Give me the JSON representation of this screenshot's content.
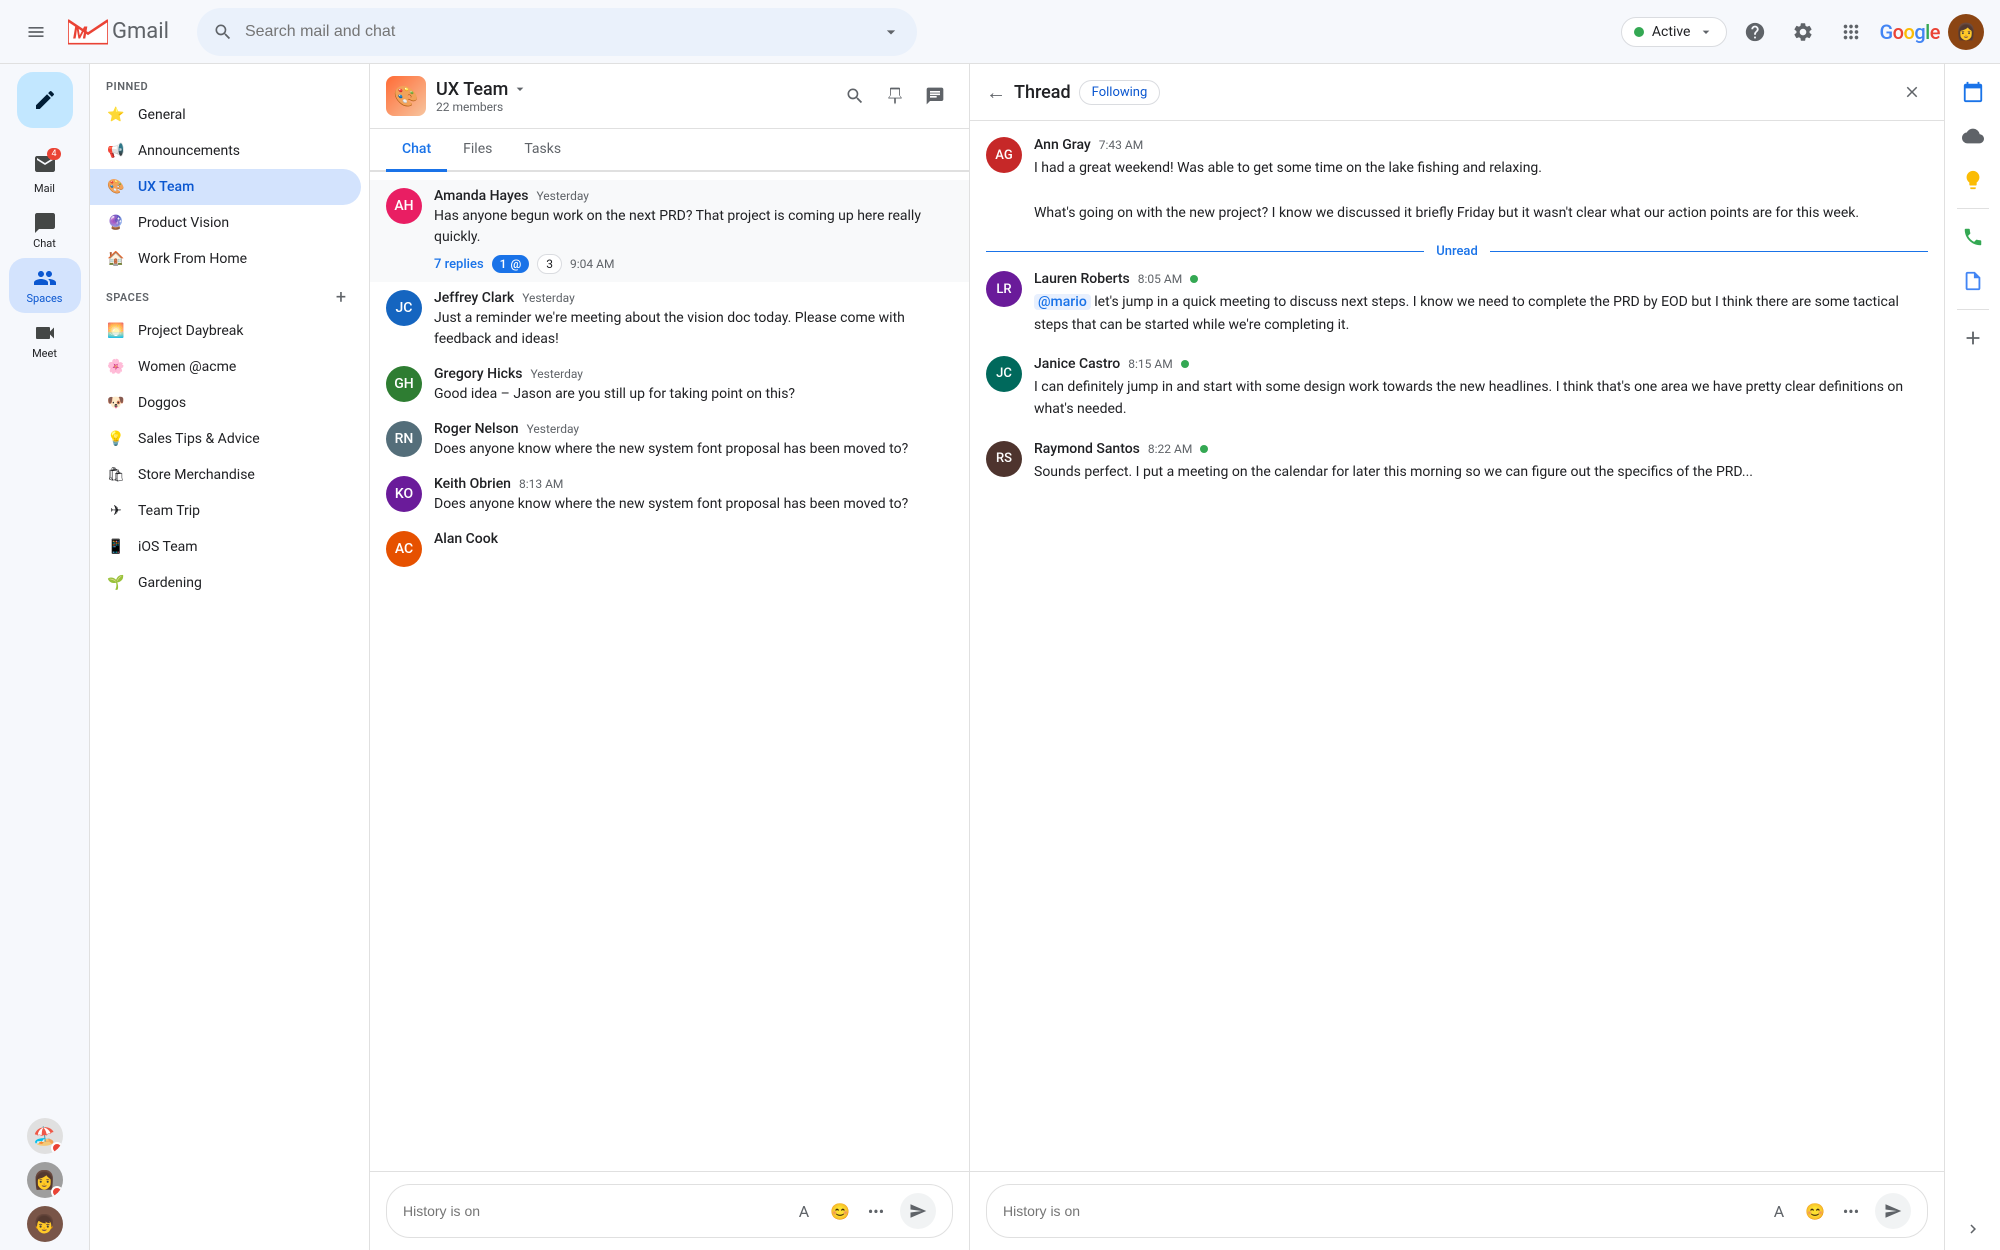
{
  "topbar": {
    "hamburger_label": "☰",
    "gmail_m": "M",
    "gmail_text": "Gmail",
    "search_placeholder": "Search mail and chat",
    "active_label": "Active",
    "active_dot_color": "#34a853",
    "help_icon": "?",
    "settings_icon": "⚙",
    "apps_icon": "⋮⋮⋮",
    "google_logo": "Google",
    "dropdown_icon": "▾"
  },
  "left_sidebar": {
    "compose_icon": "✏",
    "items": [
      {
        "id": "mail",
        "icon": "✉",
        "label": "Mail",
        "badge": "4",
        "active": false
      },
      {
        "id": "chat",
        "icon": "💬",
        "label": "Chat",
        "active": false
      },
      {
        "id": "spaces",
        "icon": "👥",
        "label": "Spaces",
        "active": true
      },
      {
        "id": "meet",
        "icon": "🎥",
        "label": "Meet",
        "active": false
      }
    ],
    "bottom_avatars": [
      {
        "id": "av1",
        "initials": "🏖",
        "badge_color": "#EA4335"
      },
      {
        "id": "av2",
        "initials": "👩",
        "badge_color": "#EA4335"
      },
      {
        "id": "av3",
        "initials": "👦",
        "badge_color": ""
      }
    ]
  },
  "nav_panel": {
    "pinned_label": "PINNED",
    "pinned_items": [
      {
        "id": "general",
        "icon": "⭐",
        "label": "General"
      },
      {
        "id": "announcements",
        "icon": "📢",
        "label": "Announcements"
      },
      {
        "id": "ux-team",
        "icon": "🎨",
        "label": "UX Team",
        "active": true
      },
      {
        "id": "product-vision",
        "icon": "🔮",
        "label": "Product Vision"
      },
      {
        "id": "work-from-home",
        "icon": "🏠",
        "label": "Work From Home"
      }
    ],
    "spaces_label": "SPACES",
    "spaces_items": [
      {
        "id": "project-daybreak",
        "icon": "🌅",
        "label": "Project Daybreak"
      },
      {
        "id": "women-acme",
        "icon": "🌸",
        "label": "Women @acme"
      },
      {
        "id": "doggos",
        "icon": "🐶",
        "label": "Doggos"
      },
      {
        "id": "sales-tips",
        "icon": "💡",
        "label": "Sales Tips & Advice"
      },
      {
        "id": "store-merchandise",
        "icon": "🛍",
        "label": "Store Merchandise"
      },
      {
        "id": "team-trip",
        "icon": "✈",
        "label": "Team Trip"
      },
      {
        "id": "ios-team",
        "icon": "📱",
        "label": "iOS Team"
      },
      {
        "id": "gardening",
        "icon": "🌱",
        "label": "Gardening"
      }
    ]
  },
  "chat_panel": {
    "space_name": "UX Team",
    "members_count": "22 members",
    "tabs": [
      {
        "id": "chat",
        "label": "Chat",
        "active": true
      },
      {
        "id": "files",
        "label": "Files",
        "active": false
      },
      {
        "id": "tasks",
        "label": "Tasks",
        "active": false
      }
    ],
    "messages": [
      {
        "id": "msg1",
        "sender": "Amanda Hayes",
        "time": "Yesterday",
        "text": "Has anyone begun work on the next PRD? That project is coming up here really quickly.",
        "replies_label": "7 replies",
        "mention_badge": "1@",
        "count_badge": "3",
        "reply_time": "9:04 AM",
        "avatar_color": "#e91e63",
        "initials": "AH",
        "highlighted": true
      },
      {
        "id": "msg2",
        "sender": "Jeffrey Clark",
        "time": "Yesterday",
        "text": "Just a reminder we're meeting about the vision doc today. Please come with feedback and ideas!",
        "avatar_color": "#1565c0",
        "initials": "JC"
      },
      {
        "id": "msg3",
        "sender": "Gregory Hicks",
        "time": "Yesterday",
        "text": "Good idea – Jason are you still up for taking point on this?",
        "avatar_color": "#2e7d32",
        "initials": "GH"
      },
      {
        "id": "msg4",
        "sender": "Roger Nelson",
        "time": "Yesterday",
        "text": "Does anyone know where the new system font proposal has been moved to?",
        "avatar_color": "#546e7a",
        "initials": "RN"
      },
      {
        "id": "msg5",
        "sender": "Keith Obrien",
        "time": "8:13 AM",
        "text": "Does anyone know where the new system font proposal has been moved to?",
        "avatar_color": "#6a1b9a",
        "initials": "KO"
      },
      {
        "id": "msg6",
        "sender": "Alan Cook",
        "time": "",
        "text": "",
        "avatar_color": "#e65100",
        "initials": "AC"
      }
    ],
    "input_placeholder": "History is on",
    "input_actions": [
      "A",
      "😊",
      "•••"
    ],
    "send_icon": "➤"
  },
  "thread_panel": {
    "title": "Thread",
    "following_label": "Following",
    "close_icon": "✕",
    "back_icon": "←",
    "messages": [
      {
        "id": "tmsg1",
        "sender": "Ann Gray",
        "time": "7:43 AM",
        "text": "I had a great weekend! Was able to get some time on the lake fishing and relaxing.\n\nWhat's going on with the new project? I know we discussed it briefly Friday but it wasn't clear what our action points are for this week.",
        "avatar_color": "#c62828",
        "initials": "AG"
      },
      {
        "id": "tmsg2",
        "sender": "Lauren Roberts",
        "time": "8:05 AM",
        "online": true,
        "text": "@mario let's jump in a quick meeting to discuss next steps. I know we need to complete the PRD by EOD but I think there are some tactical steps that can be started while we're completing it.",
        "mention": "@mario",
        "avatar_color": "#6a1b9a",
        "initials": "LR",
        "unread_before": true
      },
      {
        "id": "tmsg3",
        "sender": "Janice Castro",
        "time": "8:15 AM",
        "online": true,
        "text": "I can definitely jump in and start with some design work towards the new headlines. I think that's one area we have pretty clear definitions on what's needed.",
        "avatar_color": "#00695c",
        "initials": "JC"
      },
      {
        "id": "tmsg4",
        "sender": "Raymond Santos",
        "time": "8:22 AM",
        "online": true,
        "text": "Sounds perfect. I put a meeting on the calendar for later this morning so we can figure out the specifics of the PRD...",
        "avatar_color": "#4e342e",
        "initials": "RS"
      }
    ],
    "unread_label": "Unread",
    "input_placeholder": "History is on",
    "input_actions": [
      "A",
      "😊",
      "•••"
    ],
    "send_icon": "➤"
  },
  "right_sidebar": {
    "icons": [
      {
        "id": "calendar",
        "icon": "📅",
        "color": "#1a73e8"
      },
      {
        "id": "drive",
        "icon": "△",
        "color": "#34a853"
      },
      {
        "id": "docs",
        "icon": "📄",
        "color": "#fbbc04"
      },
      {
        "id": "phone",
        "icon": "📞",
        "color": "#34a853"
      },
      {
        "id": "tasks-icon",
        "icon": "✓",
        "color": "#4285f4"
      },
      {
        "id": "add",
        "icon": "+",
        "color": "#5f6368"
      }
    ],
    "expand_icon": "›"
  }
}
